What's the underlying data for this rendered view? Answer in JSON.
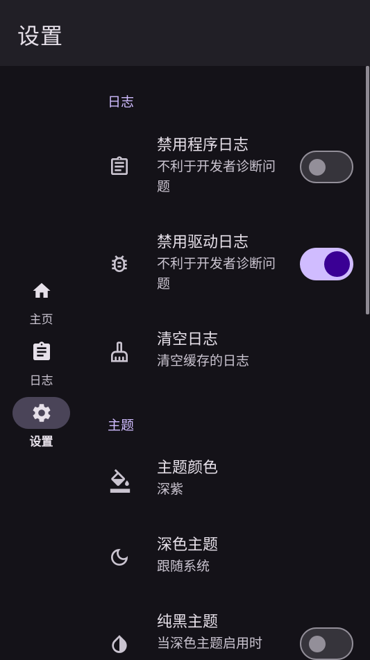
{
  "app_bar": {
    "title": "设置"
  },
  "nav": {
    "items": [
      {
        "label": "主页",
        "icon": "home-icon"
      },
      {
        "label": "日志",
        "icon": "clipboard-icon"
      },
      {
        "label": "设置",
        "icon": "gear-icon",
        "active": true
      }
    ]
  },
  "sections": {
    "log": {
      "header": "日志",
      "disable_app_log": {
        "title": "禁用程序日志",
        "subtitle": "不利于开发者诊断问题",
        "enabled": false
      },
      "disable_driver_log": {
        "title": "禁用驱动日志",
        "subtitle": "不利于开发者诊断问题",
        "enabled": true
      },
      "clear_log": {
        "title": "清空日志",
        "subtitle": "清空缓存的日志"
      }
    },
    "theme": {
      "header": "主题",
      "theme_color": {
        "title": "主题颜色",
        "subtitle": "深紫"
      },
      "dark_theme": {
        "title": "深色主题",
        "subtitle": "跟随系统"
      },
      "pure_black": {
        "title": "纯黑主题",
        "subtitle": "当深色主题启用时",
        "enabled": false
      }
    }
  },
  "colors": {
    "background": "#141218",
    "accent": "#d0bcff",
    "switch_on_knob": "#3a0094"
  }
}
